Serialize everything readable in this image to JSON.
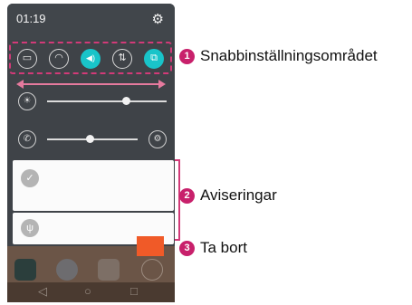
{
  "status_bar": {
    "time": "01:19",
    "settings_icon": "gear-icon"
  },
  "quick_settings": {
    "buttons": [
      {
        "name": "screen-capture-icon",
        "glyph": "▭",
        "active": false
      },
      {
        "name": "wifi-icon",
        "glyph": "◠",
        "active": false
      },
      {
        "name": "sound-icon",
        "glyph": "◀)",
        "active": true
      },
      {
        "name": "data-icon",
        "glyph": "⇅",
        "active": false
      },
      {
        "name": "rotate-icon",
        "glyph": "⧉",
        "active": true
      }
    ],
    "active_color": "#19c4c9"
  },
  "sliders": {
    "brightness": {
      "icon": "brightness-icon",
      "value": 0.66
    },
    "volume": {
      "icon": "ringtone-volume-icon",
      "value": 0.47,
      "settings_icon": "gear-icon"
    }
  },
  "notifications": [
    {
      "icon": "check-icon",
      "glyph": "✓"
    },
    {
      "icon": "usb-icon",
      "glyph": "ψ"
    }
  ],
  "navigation": {
    "back": "◁",
    "home": "○",
    "recent": "□"
  },
  "callouts": [
    {
      "number": "1",
      "label": "Snabbinställningsområdet"
    },
    {
      "number": "2",
      "label": "Aviseringar"
    },
    {
      "number": "3",
      "label": "Ta bort"
    }
  ],
  "colors": {
    "callout_accent": "#c8206b",
    "clear_button": "#f05a28",
    "panel_bg": "#3f4348"
  }
}
